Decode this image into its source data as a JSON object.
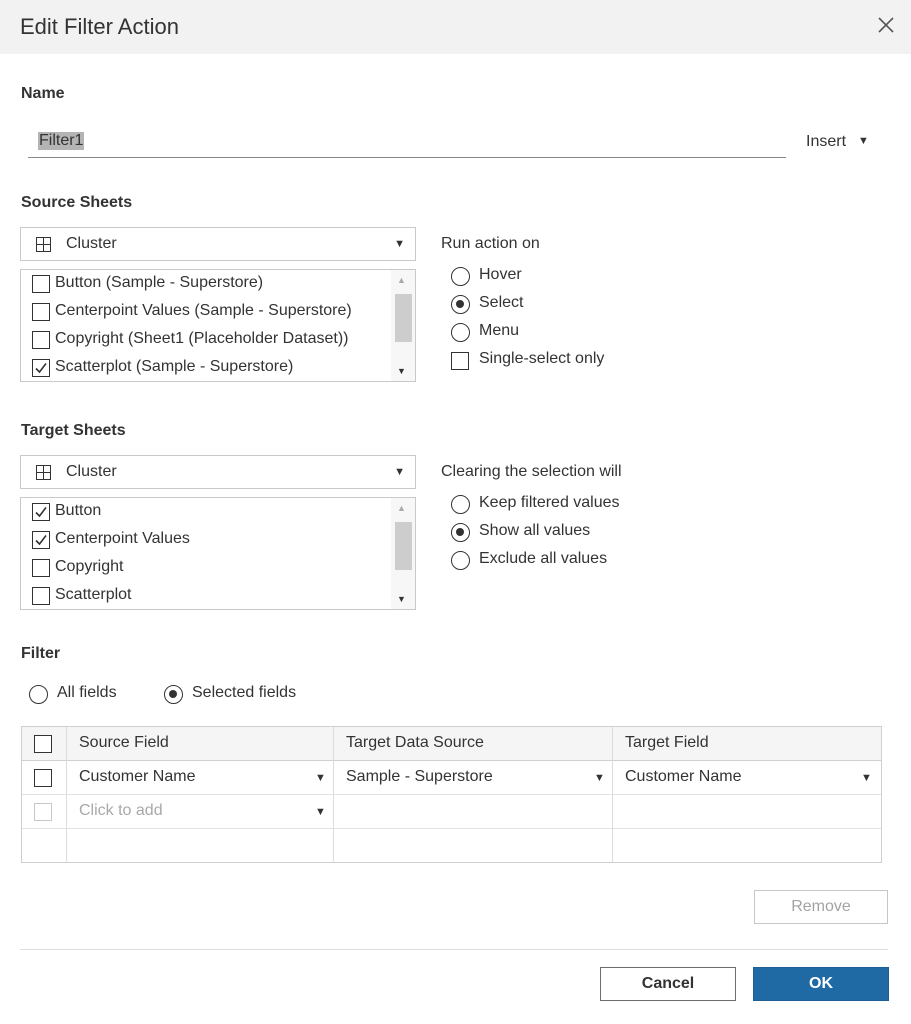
{
  "dialog": {
    "title": "Edit Filter Action"
  },
  "name_section": {
    "label": "Name",
    "value": "Filter1",
    "insert_label": "Insert"
  },
  "source": {
    "label": "Source Sheets",
    "dropdown_value": "Cluster",
    "sheets": [
      {
        "label": "Button (Sample - Superstore)",
        "checked": false
      },
      {
        "label": "Centerpoint Values (Sample - Superstore)",
        "checked": false
      },
      {
        "label": "Copyright (Sheet1 (Placeholder Dataset))",
        "checked": false
      },
      {
        "label": "Scatterplot (Sample - Superstore)",
        "checked": true
      }
    ]
  },
  "run_action": {
    "title": "Run action on",
    "options": [
      "Hover",
      "Select",
      "Menu"
    ],
    "selected": "Select",
    "single_select_label": "Single-select only",
    "single_select_checked": false
  },
  "target": {
    "label": "Target Sheets",
    "dropdown_value": "Cluster",
    "sheets": [
      {
        "label": "Button",
        "checked": true
      },
      {
        "label": "Centerpoint Values",
        "checked": true
      },
      {
        "label": "Copyright",
        "checked": false
      },
      {
        "label": "Scatterplot",
        "checked": false
      }
    ]
  },
  "clearing": {
    "title": "Clearing the selection will",
    "options": [
      "Keep filtered values",
      "Show all values",
      "Exclude all values"
    ],
    "selected": "Show all values"
  },
  "filter": {
    "label": "Filter",
    "scope_options": [
      "All fields",
      "Selected fields"
    ],
    "scope_selected": "Selected fields",
    "columns": [
      "Source Field",
      "Target Data Source",
      "Target Field"
    ],
    "rows": [
      {
        "source_field": "Customer Name",
        "target_data_source": "Sample - Superstore",
        "target_field": "Customer Name"
      }
    ],
    "add_placeholder": "Click to add"
  },
  "buttons": {
    "remove": "Remove",
    "cancel": "Cancel",
    "ok": "OK"
  },
  "icons": {
    "close": "close-icon",
    "dropdown_arrow": "caret-down-icon",
    "sheet_type": "grid-icon",
    "checkbox_checked": "checkmark-icon"
  },
  "colors": {
    "primary": "#1f6aa5",
    "titlebar": "#f2f2f2"
  }
}
